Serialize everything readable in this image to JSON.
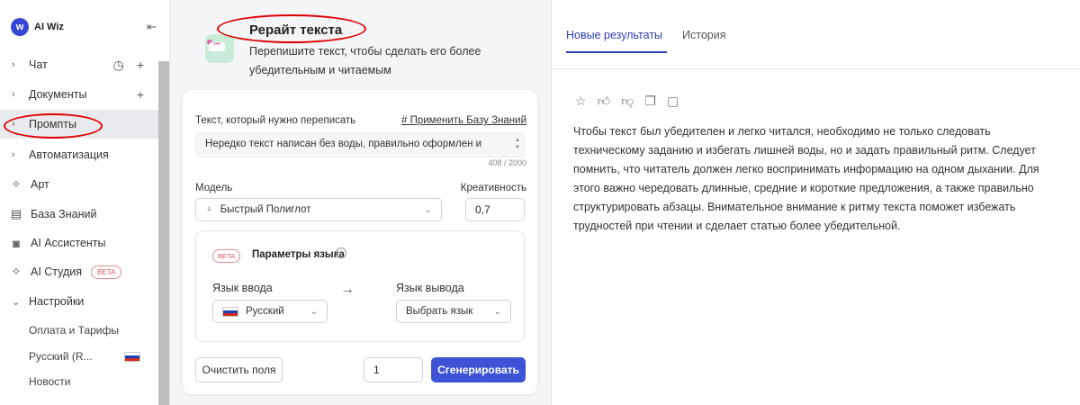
{
  "brand": {
    "name": "AI Wiz",
    "logo_letter": "w"
  },
  "sidebar": {
    "items": [
      {
        "label": "Чат"
      },
      {
        "label": "Документы"
      },
      {
        "label": "Промпты"
      },
      {
        "label": "Автоматизация"
      },
      {
        "label": "Арт"
      },
      {
        "label": "База Знаний"
      },
      {
        "label": "AI Ассистенты"
      },
      {
        "label": "AI Студия"
      },
      {
        "label": "Настройки"
      }
    ],
    "beta_label": "BETA",
    "sub_items": [
      {
        "label": "Оплата и Тарифы"
      },
      {
        "label": "Русский (R..."
      },
      {
        "label": "Новости"
      }
    ]
  },
  "tool": {
    "title": "Рерайт текста",
    "description": "Перепишите текст, чтобы сделать его более убедительным и читаемым"
  },
  "form": {
    "text_label": "Текст, который нужно переписать",
    "apply_kb": "# Применить Базу Знаний",
    "text_value": "Нередко текст написан без воды, правильно оформлен и",
    "counter": "408 / 2000",
    "model_label": "Модель",
    "model_value": "Быстрый Полиглот",
    "creativity_label": "Креативность",
    "creativity_value": "0,7",
    "lang_beta": "BETA",
    "lang_params": "Параметры языка",
    "input_lang_label": "Язык ввода",
    "input_lang_value": "Русский",
    "output_lang_label": "Язык вывода",
    "output_lang_value": "Выбрать язык",
    "clear_button": "Очистить поля",
    "count_value": "1",
    "generate_button": "Сгенерировать"
  },
  "results": {
    "tabs": [
      {
        "label": "Новые результаты"
      },
      {
        "label": "История"
      }
    ],
    "text": "Чтобы текст был убедителен и легко читался, необходимо не только следовать техническому заданию и избегать лишней воды, но и задать правильный ритм. Следует помнить, что читатель должен легко воспринимать информацию на одном дыхании. Для этого важно чередовать длинные, средние и короткие предложения, а также правильно структурировать абзацы. Внимательное внимание к ритму текста поможет избежать трудностей при чтении и сделает статью более убедительной."
  },
  "colors": {
    "accent": "#3d52d5",
    "annotation": "#e00000",
    "beta": "#d45858"
  }
}
